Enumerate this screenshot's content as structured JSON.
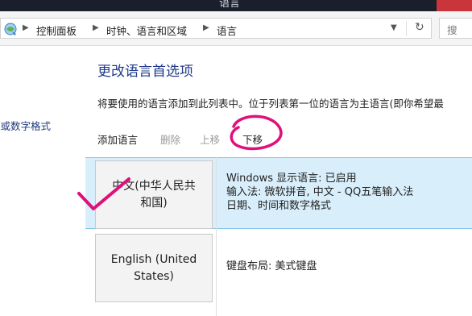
{
  "window": {
    "title": "语言"
  },
  "address_bar": {
    "breadcrumbs": [
      "控制面板",
      "时钟、语言和区域",
      "语言"
    ],
    "refresh_icon": "refresh-icon",
    "search_placeholder": "搜"
  },
  "sidebar": {
    "link": "间或数字格式"
  },
  "main": {
    "heading": "更改语言首选项",
    "description": "将要使用的语言添加到此列表中。位于列表第一位的语言为主语言(即你希望最"
  },
  "toolbar": {
    "add_label": "添加语言",
    "delete_label": "删除",
    "up_label": "上移",
    "down_label": "下移"
  },
  "languages": [
    {
      "tile_line1": "中文(中华人民共",
      "tile_line2": "和国)",
      "details": [
        "Windows 显示语言: 已启用",
        "输入法: 微软拼音, 中文 - QQ五笔输入法",
        "日期、时间和数字格式"
      ],
      "selected": true
    },
    {
      "tile_line1": "English (United",
      "tile_line2": "States)",
      "details": [
        "键盘布局: 美式键盘"
      ],
      "selected": false
    }
  ],
  "annotations": {
    "color": "#e0107a"
  },
  "colors": {
    "selected_row": "#d8eefa",
    "heading": "#1e3a8a",
    "link": "#1e3a7b"
  }
}
